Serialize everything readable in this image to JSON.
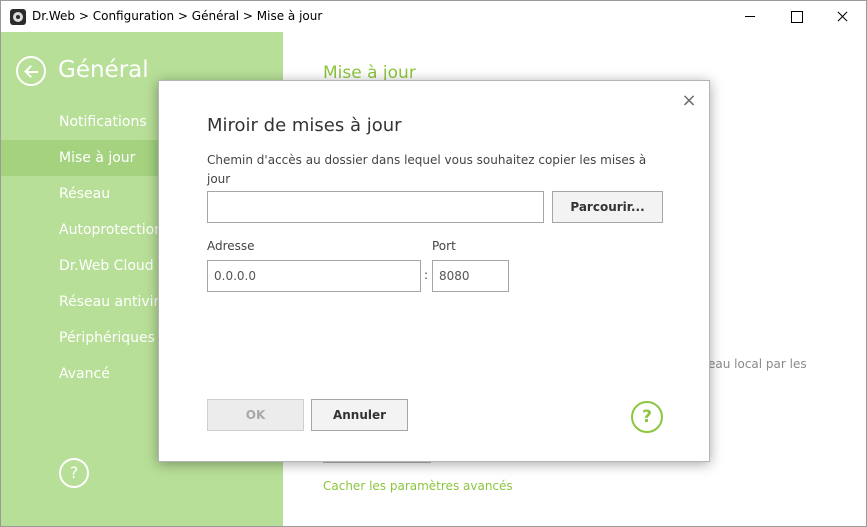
{
  "titlebar": {
    "title": "Dr.Web > Configuration > Général > Mise à jour"
  },
  "sidebar": {
    "title": "Général",
    "items": [
      {
        "label": "Notifications"
      },
      {
        "label": "Mise à jour",
        "active": true
      },
      {
        "label": "Réseau"
      },
      {
        "label": "Autoprotection"
      },
      {
        "label": "Dr.Web Cloud"
      },
      {
        "label": "Réseau antivirus"
      },
      {
        "label": "Périphériques"
      },
      {
        "label": "Avancé"
      }
    ],
    "help_glyph": "?"
  },
  "main": {
    "title": "Mise à jour",
    "partial_text": "eau local par les",
    "advanced_link": "Cacher les paramètres avancés"
  },
  "modal": {
    "close_glyph": "×",
    "title": "Miroir de mises à jour",
    "path_label": "Chemin d'accès au dossier dans lequel vous souhaitez copier les mises à jour",
    "path_value": "",
    "browse_label": "Parcourir...",
    "address_label": "Adresse",
    "address_value": "0.0.0.0",
    "colon": ":",
    "port_label": "Port",
    "port_value": "8080",
    "ok_label": "OK",
    "cancel_label": "Annuler",
    "help_glyph": "?"
  },
  "colors": {
    "sidebar_bg": "#b7df97",
    "sidebar_active": "#a4d27f",
    "accent_green": "#8cc63f"
  }
}
